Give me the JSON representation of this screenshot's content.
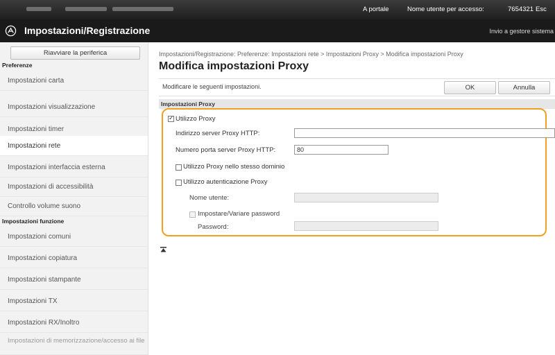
{
  "topbar": {
    "portal_link": "A portale",
    "user_label": "Nome utente per accesso:",
    "user_id": "7654321",
    "logout": "Esc"
  },
  "titlebar": {
    "title": "Impostazioni/Registrazione",
    "right_link": "Invio a gestore sistema"
  },
  "sidebar": {
    "restart_button": "Riavviare la periferica",
    "section_preferences": "Preferenze",
    "section_functions": "Impostazioni funzione",
    "items": [
      {
        "label": "Impostazioni carta"
      },
      {
        "label": "Impostazioni visualizzazione"
      },
      {
        "label": "Impostazioni timer"
      },
      {
        "label": "Impostazioni rete"
      },
      {
        "label": "Impostazioni interfaccia esterna"
      },
      {
        "label": "Impostazioni di accessibilità"
      },
      {
        "label": "Controllo volume suono"
      }
    ],
    "function_items": [
      {
        "label": "Impostazioni comuni"
      },
      {
        "label": "Impostazioni copiatura"
      },
      {
        "label": "Impostazioni stampante"
      },
      {
        "label": "Impostazioni TX"
      },
      {
        "label": "Impostazioni RX/Inoltro"
      },
      {
        "label": "Impostazioni di memorizzazione/accesso ai file"
      }
    ]
  },
  "main": {
    "breadcrumb": "Impostazioni/Registrazione: Preferenze: Impostazioni rete > Impostazioni Proxy > Modifica impostazioni Proxy",
    "page_title": "Modifica impostazioni Proxy",
    "instruction": "Modificare le seguenti impostazioni.",
    "ok_button": "OK",
    "cancel_button": "Annulla",
    "section_title": "Impostazioni Proxy",
    "use_proxy_label": "Utilizzo Proxy",
    "use_proxy_checked": true,
    "http_server_label": "Indirizzo server Proxy HTTP:",
    "http_server_value": "",
    "http_port_label": "Numero porta server Proxy HTTP:",
    "http_port_value": "80",
    "same_domain_label": "Utilizzo Proxy nello stesso dominio",
    "same_domain_checked": false,
    "auth_label": "Utilizzo autenticazione Proxy",
    "auth_checked": false,
    "username_label": "Nome utente:",
    "set_password_label": "Impostare/Variare password",
    "password_label": "Password:",
    "top_icon": "go-to-top-icon",
    "highlight_color": "#f0a01e"
  }
}
